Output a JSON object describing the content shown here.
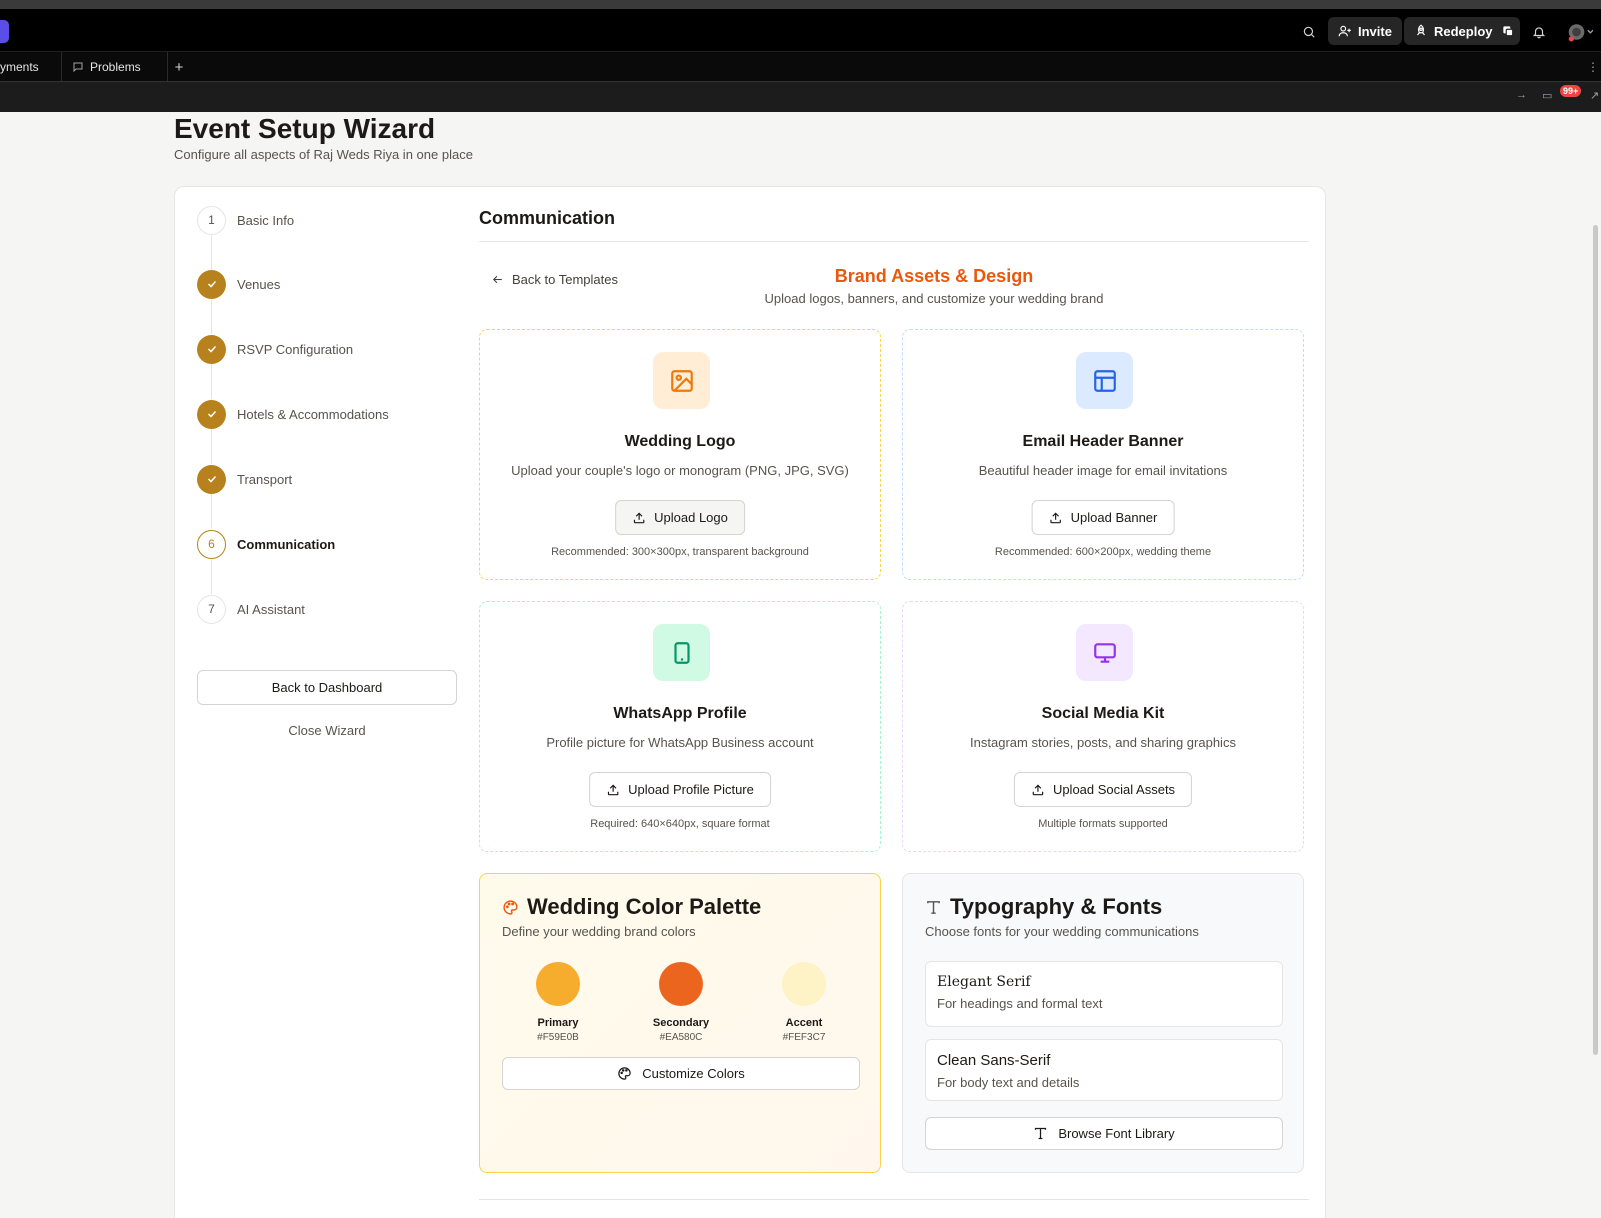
{
  "topbar": {
    "invite_label": "Invite",
    "redeploy_label": "Redeploy"
  },
  "tabs": [
    {
      "label": "yments"
    },
    {
      "label": "Problems"
    }
  ],
  "urlbar": {
    "notif_count": "99+"
  },
  "page": {
    "title": "Event Setup Wizard",
    "subtitle": "Configure all aspects of Raj Weds Riya in one place"
  },
  "steps": [
    {
      "number": "1",
      "label": "Basic Info",
      "state": "idle"
    },
    {
      "number": "2",
      "label": "Venues",
      "state": "done"
    },
    {
      "number": "3",
      "label": "RSVP Configuration",
      "state": "done"
    },
    {
      "number": "4",
      "label": "Hotels & Accommodations",
      "state": "done"
    },
    {
      "number": "5",
      "label": "Transport",
      "state": "done"
    },
    {
      "number": "6",
      "label": "Communication",
      "state": "current"
    },
    {
      "number": "7",
      "label": "AI Assistant",
      "state": "idle"
    }
  ],
  "sidebar": {
    "back_dashboard": "Back to Dashboard",
    "close_wizard": "Close Wizard"
  },
  "section": {
    "title": "Communication",
    "back_templates": "Back to Templates",
    "brand_title": "Brand Assets & Design",
    "brand_subtitle": "Upload logos, banners, and customize your wedding brand"
  },
  "cards": {
    "logo": {
      "title": "Wedding Logo",
      "desc": "Upload your couple's logo or monogram (PNG, JPG, SVG)",
      "button": "Upload Logo",
      "note": "Recommended: 300×300px, transparent background",
      "icon": "image-icon"
    },
    "banner": {
      "title": "Email Header Banner",
      "desc": "Beautiful header image for email invitations",
      "button": "Upload Banner",
      "note": "Recommended: 600×200px, wedding theme",
      "icon": "layout-icon"
    },
    "whatsapp": {
      "title": "WhatsApp Profile",
      "desc": "Profile picture for WhatsApp Business account",
      "button": "Upload Profile Picture",
      "note": "Required: 640×640px, square format",
      "icon": "tablet-icon"
    },
    "social": {
      "title": "Social Media Kit",
      "desc": "Instagram stories, posts, and sharing graphics",
      "button": "Upload Social Assets",
      "note": "Multiple formats supported",
      "icon": "monitor-icon"
    }
  },
  "palette": {
    "title": "Wedding Color Palette",
    "subtitle": "Define your wedding brand colors",
    "colors": [
      {
        "name": "Primary",
        "hex": "#F59E0B",
        "display": "#F59E0B"
      },
      {
        "name": "Secondary",
        "hex": "#EA580C",
        "display": "#EA580C"
      },
      {
        "name": "Accent",
        "hex": "#FEF3C7",
        "display": "#FEF3C7"
      }
    ],
    "button": "Customize Colors"
  },
  "typography": {
    "title": "Typography & Fonts",
    "subtitle": "Choose fonts for your wedding communications",
    "options": [
      {
        "name": "Elegant Serif",
        "desc": "For headings and formal text"
      },
      {
        "name": "Clean Sans-Serif",
        "desc": "For body text and details"
      }
    ],
    "button": "Browse Font Library"
  },
  "colors": {
    "step_done": "#B7821D",
    "brand_heading": "#EA580C"
  }
}
